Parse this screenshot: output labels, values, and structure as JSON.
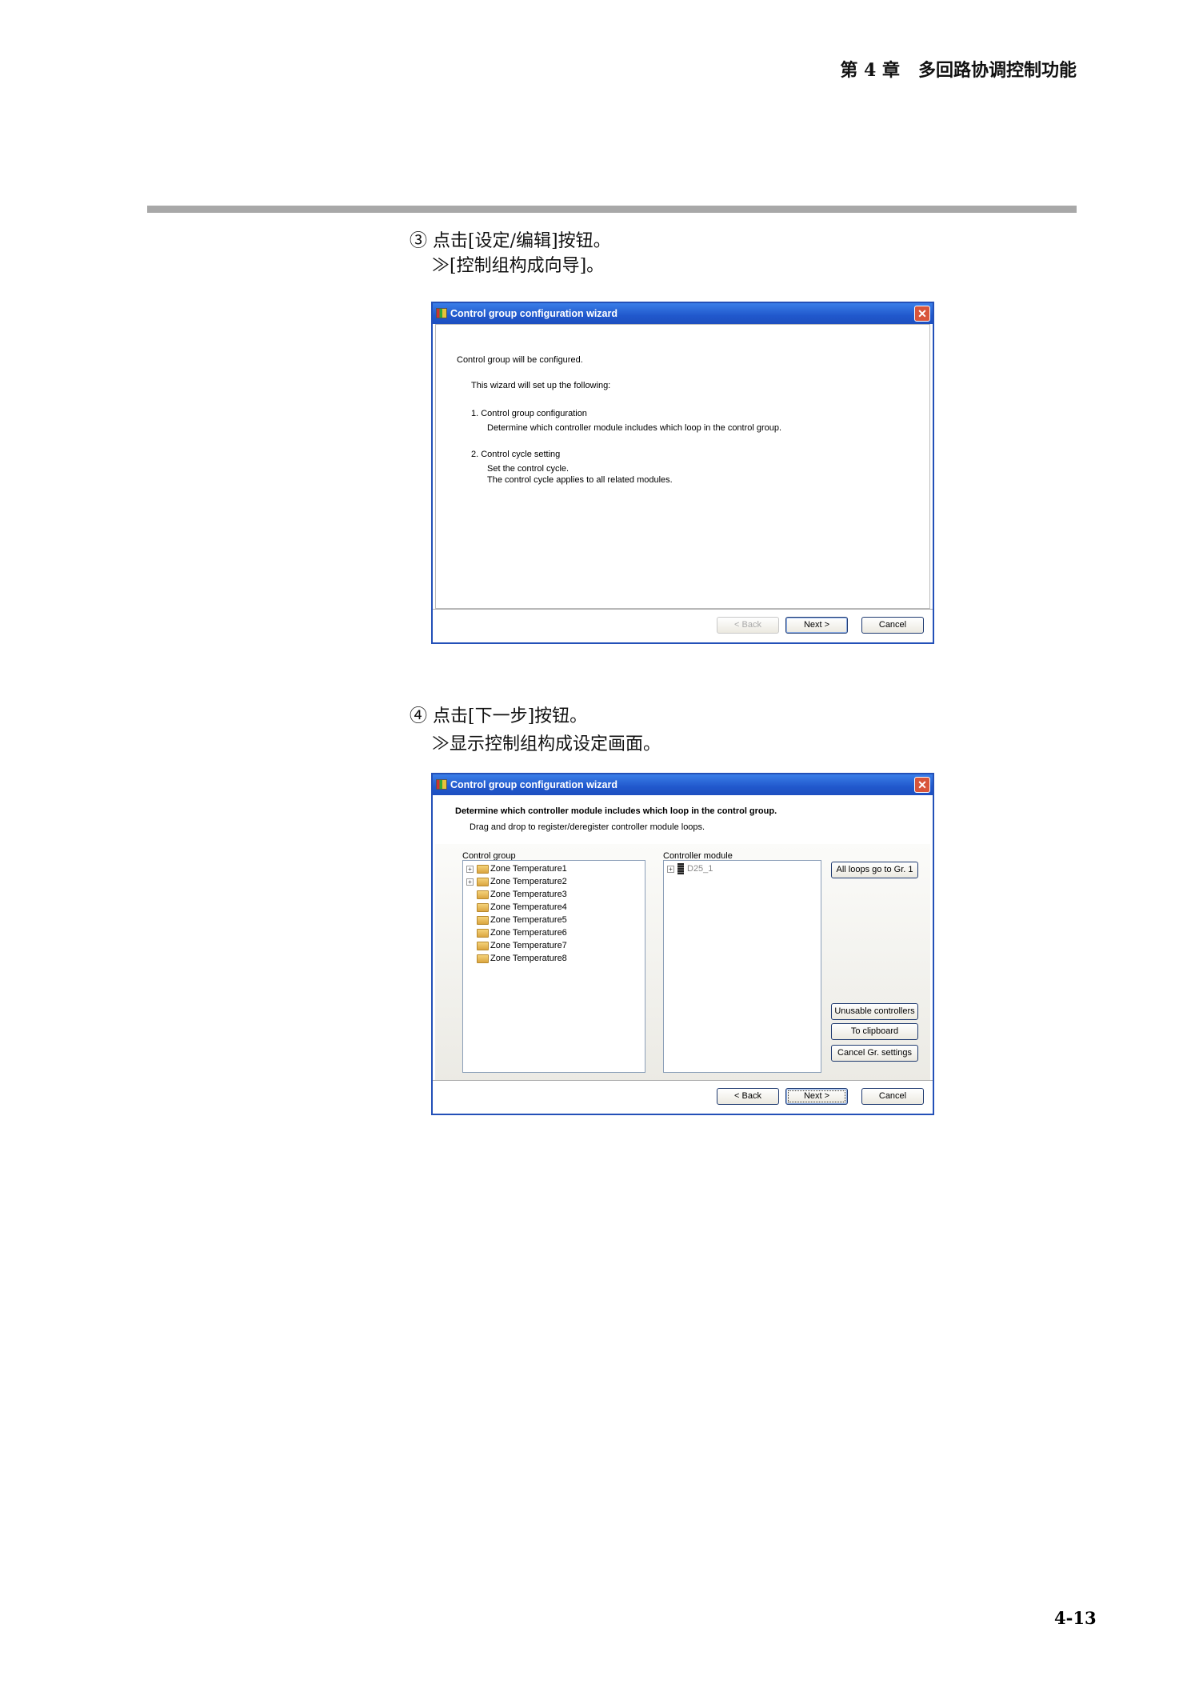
{
  "header": {
    "chapter": "第 4 章   多回路协调控制功能"
  },
  "steps": [
    {
      "line1": "③ 点击[设定/编辑]按钮。",
      "line2": "≫[控制组构成向导]。"
    },
    {
      "line1": "④ 点击[下一步]按钮。",
      "line2": "≫显示控制组构成设定画面。"
    }
  ],
  "dialog1": {
    "title": "Control group configuration wizard",
    "intro": "Control group will be configured.",
    "setup": "This wizard will set up the following:",
    "item1": "1. Control group configuration",
    "item1_desc": "Determine which controller module includes which loop in the control group.",
    "item2": "2. Control cycle setting",
    "item2_desc1": "Set the control cycle.",
    "item2_desc2": "The control cycle applies to all related modules.",
    "back": "< Back",
    "next": "Next >",
    "cancel": "Cancel"
  },
  "dialog2": {
    "title": "Control group configuration wizard",
    "heading": "Determine which controller module includes which loop in the control group.",
    "subheading": "Drag and drop to register/deregister controller module loops.",
    "control_group_label": "Control group",
    "controller_module_label": "Controller module",
    "groups": [
      {
        "label": "Zone Temperature1",
        "expandable": true
      },
      {
        "label": "Zone Temperature2",
        "expandable": true
      },
      {
        "label": "Zone Temperature3",
        "expandable": false
      },
      {
        "label": "Zone Temperature4",
        "expandable": false
      },
      {
        "label": "Zone Temperature5",
        "expandable": false
      },
      {
        "label": "Zone Temperature6",
        "expandable": false
      },
      {
        "label": "Zone Temperature7",
        "expandable": false
      },
      {
        "label": "Zone Temperature8",
        "expandable": false
      }
    ],
    "modules": [
      {
        "label": "D25_1",
        "expandable": true
      }
    ],
    "all_loops": "All loops go to Gr. 1",
    "unusable": "Unusable controllers",
    "clipboard": "To clipboard",
    "cancel_gr": "Cancel Gr. settings",
    "back": "< Back",
    "next": "Next >",
    "cancel": "Cancel"
  },
  "page_number": "4-13"
}
